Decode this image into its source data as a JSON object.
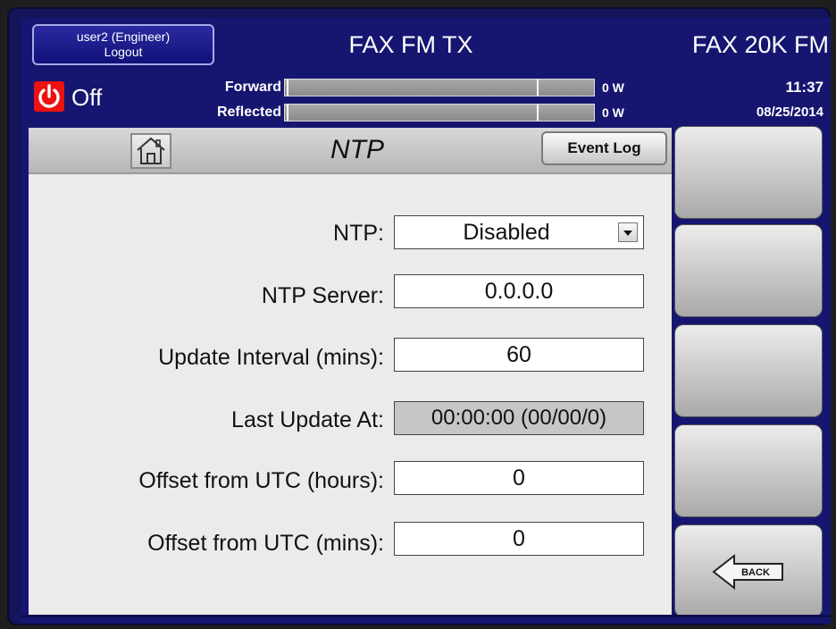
{
  "header": {
    "user_line1": "user2 (Engineer)",
    "user_line2": "Logout",
    "title_center": "FAX FM TX",
    "title_right": "FAX 20K FM"
  },
  "status": {
    "power_state": "Off",
    "power_icon": "power-icon",
    "forward_label": "Forward",
    "forward_value": "0 W",
    "reflected_label": "Reflected",
    "reflected_value": "0 W",
    "time": "11:37",
    "date": "08/25/2014"
  },
  "page": {
    "title": "NTP",
    "home_icon": "home-icon",
    "event_log_label": "Event Log"
  },
  "form": {
    "ntp_label": "NTP:",
    "ntp_value": "Disabled",
    "server_label": "NTP Server:",
    "server_value": "0.0.0.0",
    "interval_label": "Update Interval (mins):",
    "interval_value": "60",
    "last_update_label": "Last Update At:",
    "last_update_value": "00:00:00 (00/00/0)",
    "offset_hours_label": "Offset from UTC (hours):",
    "offset_hours_value": "0",
    "offset_mins_label": "Offset from UTC (mins):",
    "offset_mins_value": "0"
  },
  "side": {
    "back_label": "BACK"
  },
  "colors": {
    "frame_blue": "#161671",
    "power_red": "#e11111",
    "panel_gray": "#ebebeb"
  }
}
